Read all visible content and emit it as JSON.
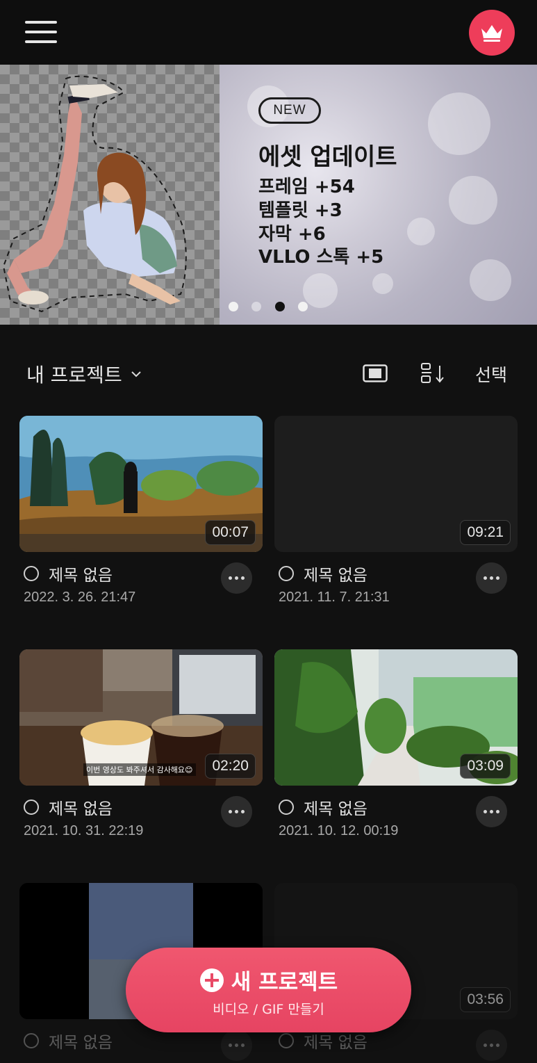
{
  "header": {
    "menu_icon": "hamburger-menu-icon",
    "premium_icon": "crown-icon",
    "premium_color": "#ee3d5a"
  },
  "banner": {
    "badge": "NEW",
    "title": "에셋 업데이트",
    "lines": [
      "프레임 +54",
      "템플릿 +3",
      "자막 +6",
      "VLLO 스톡 +5"
    ],
    "page_count": 4,
    "active_page": 3
  },
  "section": {
    "title": "내 프로젝트",
    "select_label": "선택",
    "layout_icon": "layout-toggle-icon",
    "sort_icon": "sort-icon"
  },
  "projects": [
    {
      "title": "제목 없음",
      "date": "2022. 3. 26. 21:47",
      "duration": "00:07"
    },
    {
      "title": "제목 없음",
      "date": "2021. 11. 7. 21:31",
      "duration": "09:21"
    },
    {
      "title": "제목 없음",
      "date": "2021. 10. 31. 22:19",
      "duration": "02:20",
      "caption": "이번 영상도 봐주셔서 감사해요😊"
    },
    {
      "title": "제목 없음",
      "date": "2021. 10. 12. 00:19",
      "duration": "03:09"
    },
    {
      "title": "제목 없음",
      "date": "",
      "duration": ""
    },
    {
      "title": "제목 없음",
      "date": "",
      "duration": "03:56"
    }
  ],
  "fab": {
    "label": "새 프로젝트",
    "sub_label": "비디오 / GIF 만들기",
    "icon": "plus-circle-icon",
    "color": "#e94a66"
  }
}
